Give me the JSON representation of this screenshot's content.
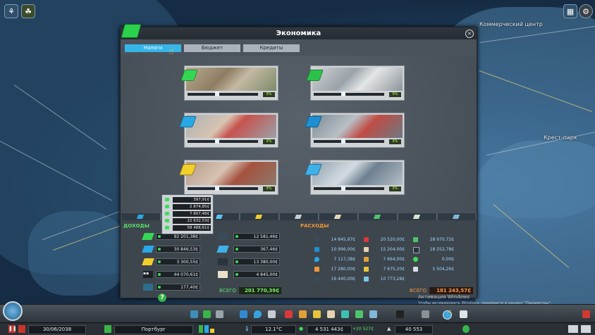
{
  "map": {
    "labels": [
      {
        "text": "Коммерческий центр",
        "class": ""
      },
      {
        "text": "Крест-парк",
        "class": ""
      }
    ]
  },
  "window": {
    "title": "Экономика",
    "tabs": [
      {
        "label": "Налоги",
        "active": true
      },
      {
        "label": "Бюджет",
        "active": false
      },
      {
        "label": "Кредиты",
        "active": false
      }
    ]
  },
  "zones": [
    {
      "name": "residential-low",
      "tax": "9%",
      "color": "#36d654",
      "level": 0.41
    },
    {
      "name": "residential-high",
      "tax": "9%",
      "color": "#2cc24a",
      "level": 0.41
    },
    {
      "name": "commercial-low",
      "tax": "9%",
      "color": "#29a8e6",
      "level": 0.41
    },
    {
      "name": "commercial-high",
      "tax": "9%",
      "color": "#1e8fd0",
      "level": 0.41
    },
    {
      "name": "industrial",
      "tax": "9%",
      "color": "#f2cf2a",
      "level": 0.41
    },
    {
      "name": "office",
      "tax": "9%",
      "color": "#3fb0e8",
      "level": 0.41
    }
  ],
  "popup_values": [
    "397,91₵",
    "2 874,85₵",
    "7 807,48₵",
    "22 632,53₵",
    "58 488,61₵"
  ],
  "income": {
    "title": "ДОХОДЫ",
    "left": [
      "92 201,38₵",
      "30 846,53₵",
      "3 300,55₵",
      "44 070,61₵",
      "177,40₵"
    ],
    "right": [
      "12 581,46₵",
      "367,46₵",
      "13 380,00₵",
      "4 845,00₵"
    ],
    "total_label": "ВСЕГО",
    "total_value": "201 770,39₵"
  },
  "expenses": {
    "title": "РАСХОДЫ",
    "col1": [
      "14 845,97₵",
      "10 996,00₵",
      "7 117,38₵",
      "17 280,00₵",
      "16 440,00₵"
    ],
    "col2": [
      "20 520,00₵",
      "15 204,00₵",
      "7 664,00₵",
      "7 675,20₵",
      "10 773,28₵"
    ],
    "col3": [
      "28 970,72₵",
      "18 252,78₵",
      "0,00₵",
      "5 504,26₵",
      ""
    ],
    "total_label": "ВСЕГО",
    "total_value": "181 243,57₵"
  },
  "watermark": {
    "line1": "Активация Windows",
    "line2": "Чтобы активировать Windows, перейдите в раздел \"Параметры\"."
  },
  "statusbar": {
    "date": "30/06/2038",
    "city": "Портбург",
    "temperature": "12.1°C",
    "money": "4 531 443₵",
    "income_delta": "+20 527₵",
    "population": "40 553"
  }
}
